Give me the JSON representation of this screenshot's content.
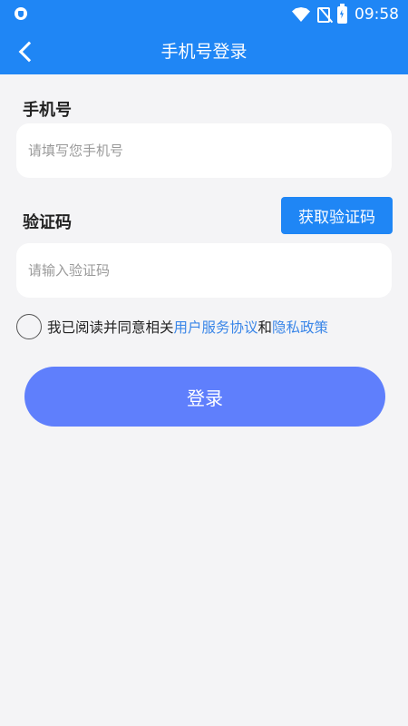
{
  "status_bar": {
    "time": "09:58",
    "icons": [
      "shield-icon",
      "wifi-icon",
      "no-sim-icon",
      "battery-charging-icon"
    ],
    "color": "#1f86f5"
  },
  "header": {
    "title": "手机号登录",
    "back_icon": "chevron-left-icon"
  },
  "form": {
    "phone_label": "手机号",
    "phone_placeholder": "请填写您手机号",
    "phone_value": "",
    "code_label": "验证码",
    "code_placeholder": "请输入验证码",
    "code_value": "",
    "get_code_label": "获取验证码"
  },
  "agreement": {
    "checked": false,
    "prefix": "我已阅读并同意相关",
    "terms_link": "用户服务协议",
    "conjunction": "和",
    "privacy_link": "隐私政策",
    "link_color": "#3a86e8"
  },
  "login": {
    "label": "登录",
    "color": "#5f7ffc"
  }
}
